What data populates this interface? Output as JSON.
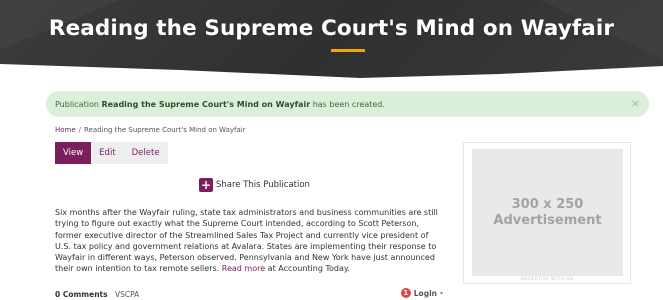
{
  "header": {
    "title": "Reading the Supreme Court's Mind on Wayfair"
  },
  "alert": {
    "prefix": "Publication",
    "publication_title": "Reading the Supreme Court's Mind on Wayfair",
    "suffix": "has been created.",
    "close_glyph": "×"
  },
  "breadcrumb": {
    "home": "Home",
    "separator": "/",
    "current": "Reading the Supreme Court's Mind on Wayfair"
  },
  "tabs": [
    {
      "label": "View",
      "active": true
    },
    {
      "label": "Edit",
      "active": false
    },
    {
      "label": "Delete",
      "active": false
    }
  ],
  "share": {
    "icon": "plus-icon",
    "icon_glyph": "+",
    "label": "Share This Publication"
  },
  "article": {
    "body": "Six months after the Wayfair ruling, state tax administrators and business communities are still trying to figure out exactly what the Supreme Court intended, according to Scott Peterson, former executive director of the Streamlined Sales Tax Project and currently vice president of U.S. tax policy and government relations at Avalara. States are implementing their response to Wayfair in different ways, Peterson observed. Pennsylvania and New York have just announced their own intention to tax remote sellers.",
    "read_more": "Read more",
    "suffix": "at Accounting Today."
  },
  "comments": {
    "count_label": "0 Comments",
    "org": "VSCPA",
    "login_badge": "1",
    "login_label": "Login",
    "login_caret": "▾"
  },
  "ad": {
    "size": "300 x 250",
    "text": "Advertisement",
    "note": "ADVERTISE WITH US"
  },
  "colors": {
    "accent": "#7a1f5c",
    "hero_bg": "#333436",
    "hero_underline": "#f0a500",
    "alert_bg": "#dcefdb",
    "login_badge": "#e0473f"
  }
}
